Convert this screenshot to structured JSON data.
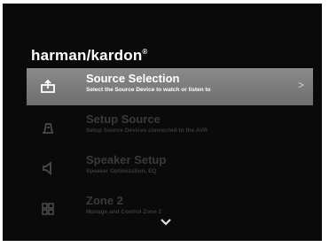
{
  "brand": {
    "name": "harman/kardon",
    "trademark": "®"
  },
  "menu": {
    "items": [
      {
        "title": "Source Selection",
        "subtitle": "Select the Source Device to watch or listen to",
        "icon": "input-source-icon",
        "selected": true
      },
      {
        "title": "Setup Source",
        "subtitle": "Setup Source Devices connected to the AVR",
        "icon": "setup-source-icon",
        "selected": false
      },
      {
        "title": "Speaker Setup",
        "subtitle": "Speaker Optimization, EQ",
        "icon": "speaker-icon",
        "selected": false
      },
      {
        "title": "Zone 2",
        "subtitle": "Manage and Control Zone 2",
        "icon": "zone-grid-icon",
        "selected": false
      }
    ],
    "selected_arrow": ">"
  },
  "colors": {
    "background": "#0a0a0a",
    "highlight": "#7c7c7c",
    "dimmed_text": "#3a3a3a"
  }
}
